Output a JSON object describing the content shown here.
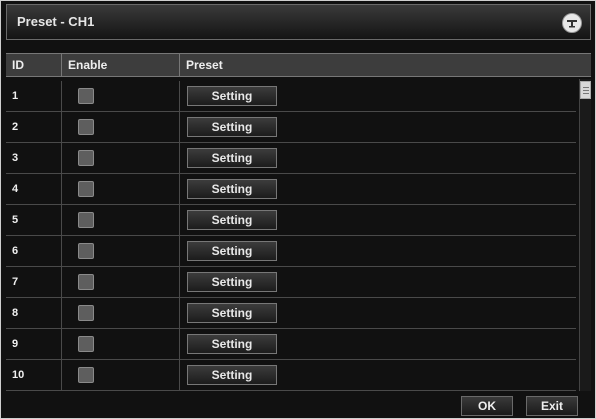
{
  "window": {
    "title": "Preset - CH1",
    "close_icon": "close-icon"
  },
  "table": {
    "headers": {
      "id": "ID",
      "enable": "Enable",
      "preset": "Preset"
    },
    "rows": [
      {
        "id": "1",
        "enabled": false,
        "button": "Setting"
      },
      {
        "id": "2",
        "enabled": false,
        "button": "Setting"
      },
      {
        "id": "3",
        "enabled": false,
        "button": "Setting"
      },
      {
        "id": "4",
        "enabled": false,
        "button": "Setting"
      },
      {
        "id": "5",
        "enabled": false,
        "button": "Setting"
      },
      {
        "id": "6",
        "enabled": false,
        "button": "Setting"
      },
      {
        "id": "7",
        "enabled": false,
        "button": "Setting"
      },
      {
        "id": "8",
        "enabled": false,
        "button": "Setting"
      },
      {
        "id": "9",
        "enabled": false,
        "button": "Setting"
      },
      {
        "id": "10",
        "enabled": false,
        "button": "Setting"
      }
    ]
  },
  "footer": {
    "ok_label": "OK",
    "exit_label": "Exit"
  }
}
